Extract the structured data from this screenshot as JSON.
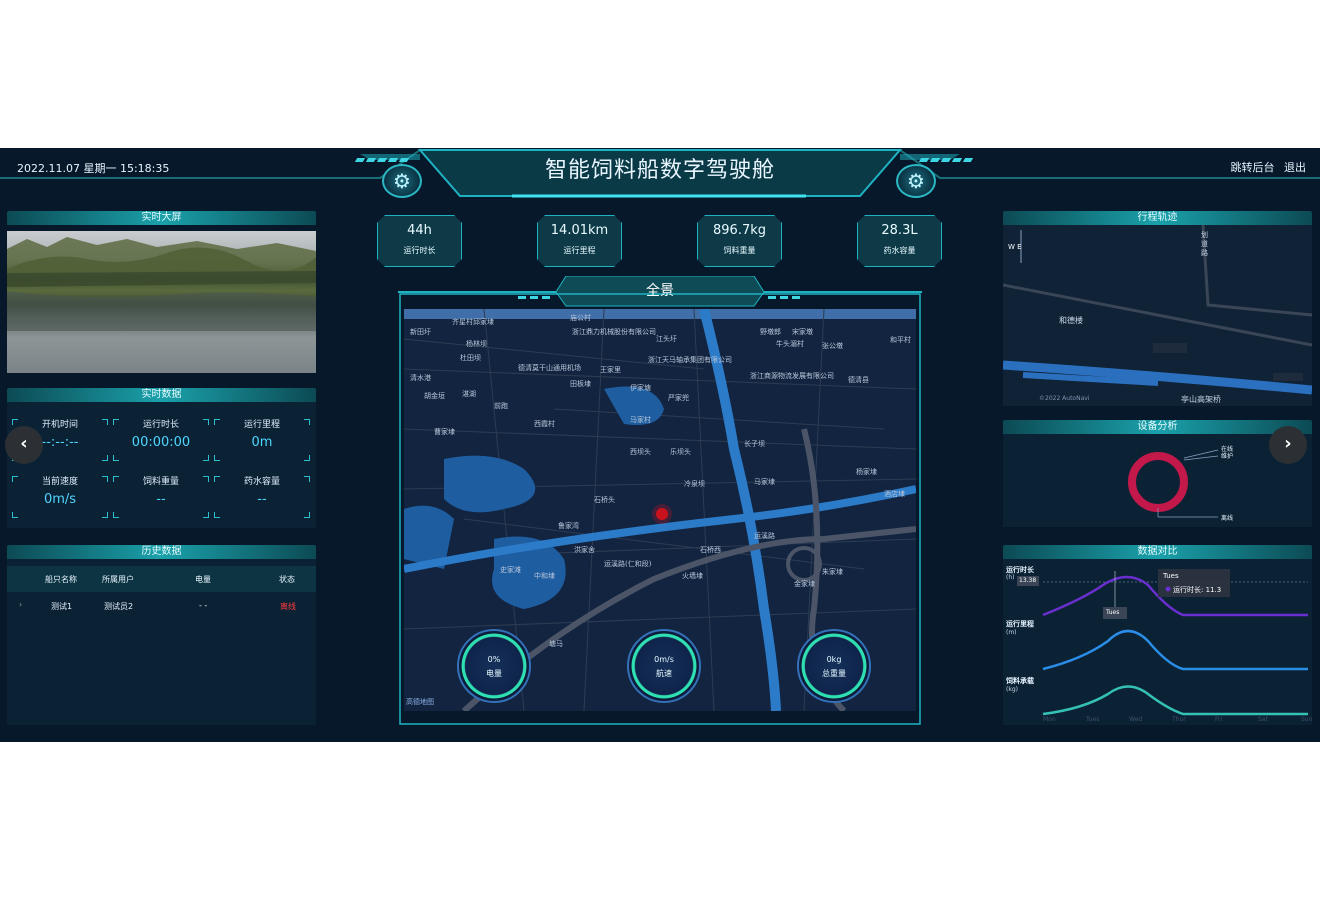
{
  "header": {
    "datetime": "2022.11.07 星期一 15:18:35",
    "title": "智能饲料船数字驾驶舱",
    "link_backend": "跳转后台",
    "link_logout": "退出"
  },
  "left": {
    "video_title": "实时大屏",
    "realtime_title": "实时数据",
    "realtime": [
      {
        "label": "开机时间",
        "value": "--:--:--"
      },
      {
        "label": "运行时长",
        "value": "00:00:00"
      },
      {
        "label": "运行里程",
        "value": "0m"
      },
      {
        "label": "当前速度",
        "value": "0m/s"
      },
      {
        "label": "饲料重量",
        "value": "--"
      },
      {
        "label": "药水容量",
        "value": "--"
      }
    ],
    "history_title": "历史数据",
    "history_columns": [
      "船只名称",
      "所属用户",
      "电量",
      "状态"
    ],
    "history_rows": [
      {
        "expand": "›",
        "name": "测试1",
        "user": "测试员2",
        "power": "- -",
        "status": "离线"
      }
    ]
  },
  "center": {
    "stats": [
      {
        "value": "44h",
        "label": "运行时长"
      },
      {
        "value": "14.01km",
        "label": "运行里程"
      },
      {
        "value": "896.7kg",
        "label": "饲料重量"
      },
      {
        "value": "28.3L",
        "label": "药水容量"
      }
    ],
    "map_title": "全景",
    "map_labels": [
      "齐星村邱家埭",
      "新田圩",
      "杨林坝",
      "杜田坝",
      "浙江鼎力机械股份有限公司",
      "江头圩",
      "德清莫干山通用机场",
      "王家里",
      "浙江天马轴承集团有限公司",
      "野墩郎",
      "牛头湄村",
      "宋家墩",
      "张公墩",
      "和平村",
      "清水港",
      "胡金垣",
      "湛湖",
      "前跑",
      "田板埭",
      "严家兜",
      "伊家塘",
      "浙江商源物流发展有限公司",
      "德清县",
      "曹家埭",
      "西霞村",
      "石桥头",
      "冷泉坝",
      "西坝头",
      "乐坝头",
      "长子坝",
      "马家埭",
      "杨家埭",
      "鲁家湾",
      "洪家舍",
      "运溪路(仁和段)",
      "石桥西",
      "火墙埭",
      "金家埭",
      "史家滩",
      "中和埭",
      "塘马",
      "运溪路",
      "朱家埭",
      "庙公村",
      "马家村",
      "酒店埭"
    ],
    "map_attrib": "高德地图",
    "gauges": [
      {
        "value": "0%",
        "label": "电量"
      },
      {
        "value": "0m/s",
        "label": "航速"
      },
      {
        "value": "0kg",
        "label": "总重量"
      }
    ]
  },
  "right": {
    "track_title": "行程轨迹",
    "track_labels": {
      "road": "划道路",
      "place": "和德楼",
      "bridge": "亭山高架桥",
      "attrib": "©2022 AutoNavi",
      "compass": "W E"
    },
    "device_title": "设备分析",
    "device_legend": [
      "在线",
      "维护",
      "离线"
    ],
    "device_data": [
      {
        "name": "在线",
        "value": 0
      },
      {
        "name": "维护",
        "value": 0
      },
      {
        "name": "离线",
        "value": 1
      }
    ],
    "compare_title": "数据对比",
    "compare_rows": [
      {
        "label": "运行时长",
        "unit": "(h)",
        "color": "#7a3fd9"
      },
      {
        "label": "运行里程",
        "unit": "(m)",
        "color": "#2a8de8"
      },
      {
        "label": "饲料承载",
        "unit": "(kg)",
        "color": "#35c1b4"
      }
    ],
    "compare_pointer": "13.38",
    "compare_x_label": "Tues",
    "tooltip": {
      "title": "Tues",
      "text": "运行时长: 11.3"
    },
    "x_axis": [
      "Mon",
      "Tues",
      "Wed",
      "Thur",
      "Fri",
      "Sat",
      "Sun"
    ]
  },
  "nav": {
    "prev": "‹",
    "next": "›"
  },
  "colors": {
    "bg": "#06182a",
    "accent": "#1fb3c2",
    "offline": "#ff3b3b",
    "value": "#4fd6ff"
  }
}
